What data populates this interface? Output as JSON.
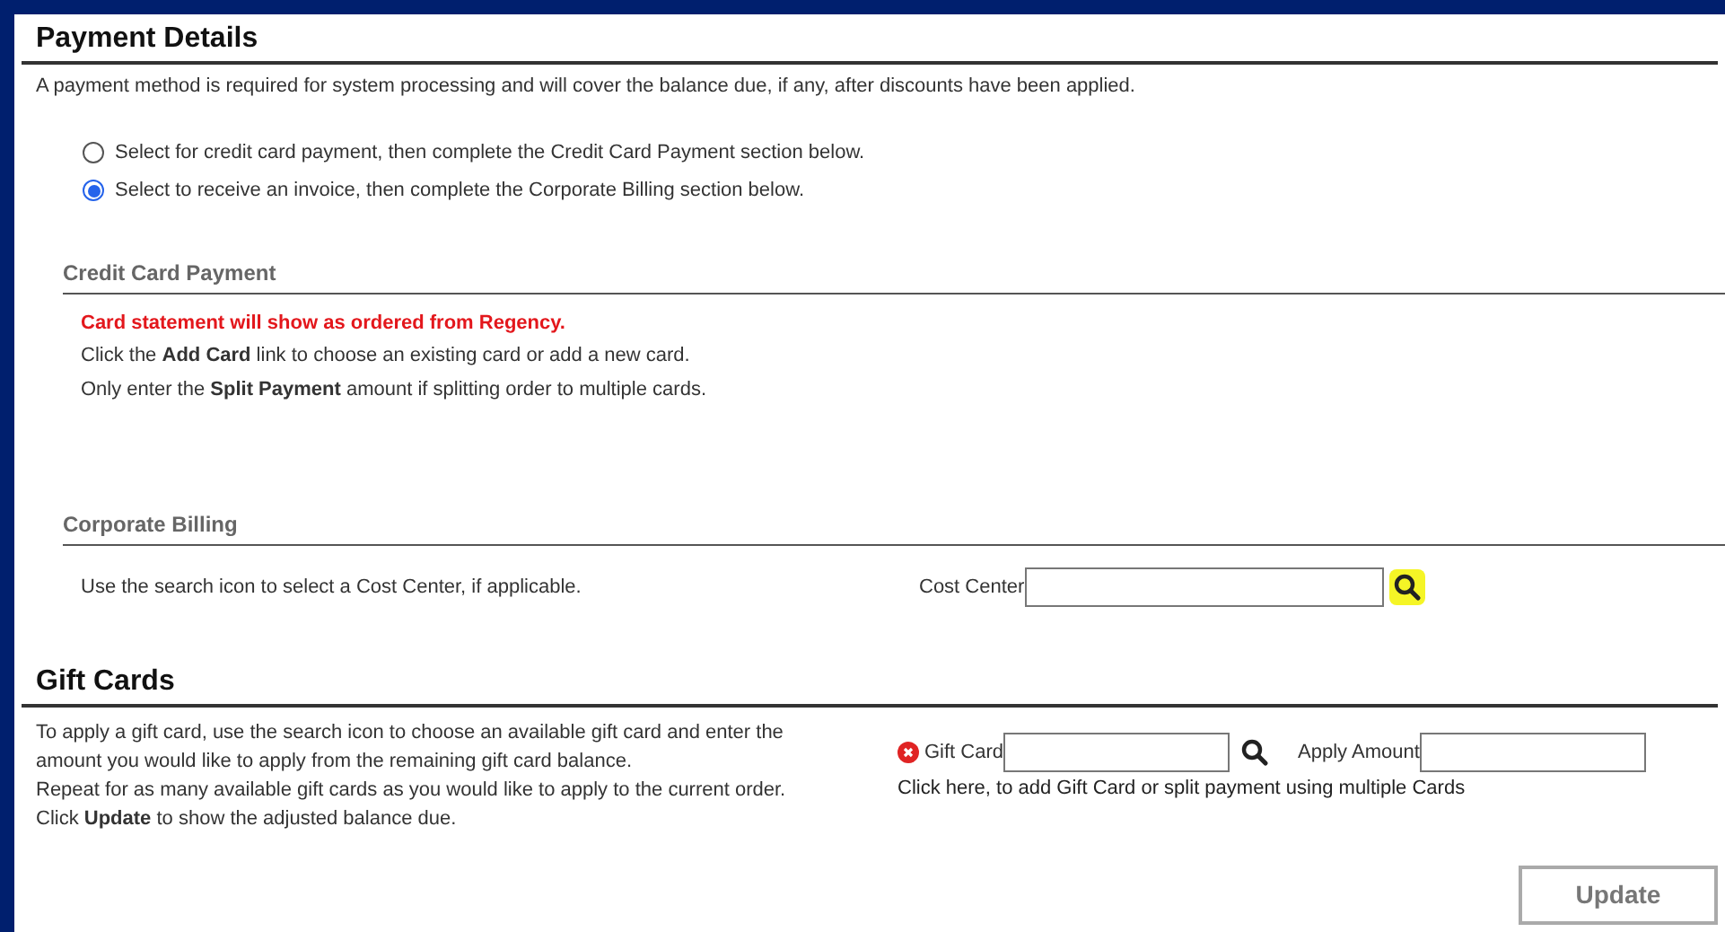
{
  "payment_details": {
    "title": "Payment Details",
    "description": "A payment method is required for system processing and will cover the balance due, if any, after discounts have been applied.",
    "options": [
      {
        "label": "Select for credit card payment, then complete the Credit Card Payment section below.",
        "selected": false
      },
      {
        "label": "Select to receive an invoice, then complete the Corporate Billing section below.",
        "selected": true
      }
    ]
  },
  "credit_card_payment": {
    "title": "Credit Card Payment",
    "notice": "Card statement will show as ordered from Regency.",
    "lines": [
      "Click the **Add Card** link to choose an existing card or add a new card.",
      "Only enter the **Split Payment** amount if splitting order to multiple cards."
    ]
  },
  "corporate_billing": {
    "title": "Corporate Billing",
    "instruction": "Use the search icon to select a Cost Center, if applicable.",
    "cost_center_label": "Cost Center"
  },
  "gift_cards": {
    "title": "Gift Cards",
    "paragraphs": [
      "To apply a gift card, use the search icon to choose an available gift card and enter the amount you would like to apply from the remaining gift card balance.",
      "Repeat for as many available gift cards as you would like to apply to the current order.",
      "Click **Update** to show the adjusted balance due."
    ],
    "gift_card_label": "Gift Card",
    "apply_amount_label": "Apply Amount",
    "add_link": "Click here, to add Gift Card or split payment using multiple Cards"
  },
  "update_button": "Update"
}
